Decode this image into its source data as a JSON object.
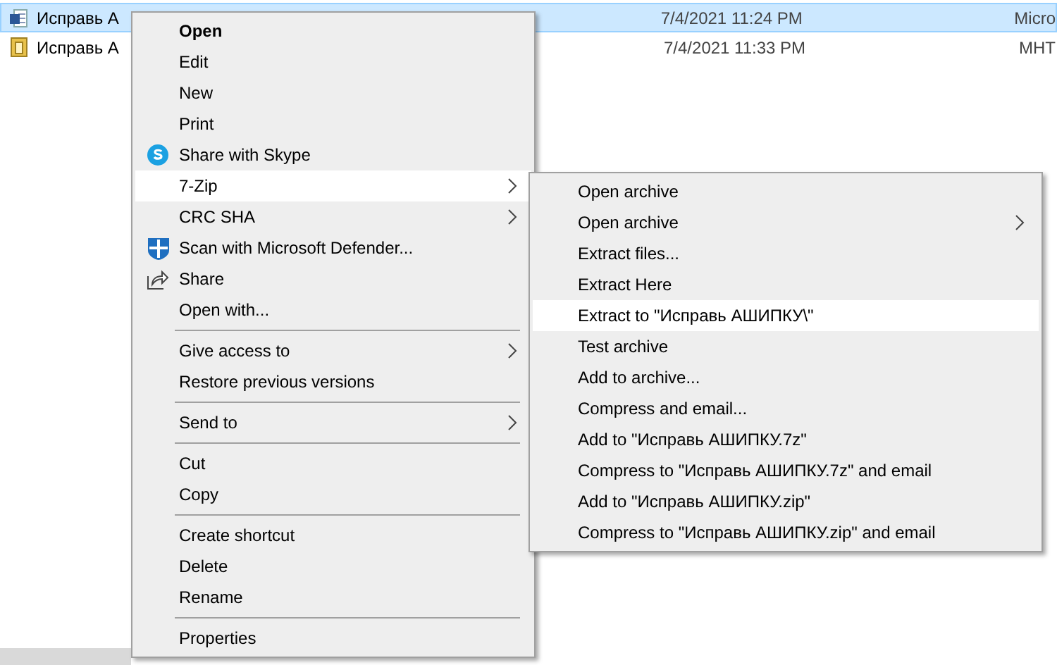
{
  "files": [
    {
      "name": "Исправь А",
      "date": "7/4/2021 11:24 PM",
      "type": "Micro",
      "selected": true
    },
    {
      "name": "Исправь А",
      "date": "7/4/2021 11:33 PM",
      "type": "MHT",
      "selected": false
    }
  ],
  "context_menu": {
    "items": [
      {
        "kind": "item",
        "label": "Open",
        "default": true,
        "selected": false
      },
      {
        "kind": "item",
        "label": "Edit",
        "selected": false
      },
      {
        "kind": "item",
        "label": "New",
        "selected": false
      },
      {
        "kind": "item",
        "label": "Print",
        "selected": false
      },
      {
        "kind": "item",
        "label": "Share with Skype",
        "selected": false
      },
      {
        "kind": "item",
        "label": "7-Zip",
        "submenu": true,
        "selected": true
      },
      {
        "kind": "item",
        "label": "CRC SHA",
        "submenu": true,
        "selected": false
      },
      {
        "kind": "item",
        "label": "Scan with Microsoft Defender...",
        "selected": false
      },
      {
        "kind": "item",
        "label": "Share",
        "selected": false
      },
      {
        "kind": "item",
        "label": "Open with...",
        "selected": false
      },
      {
        "kind": "separator"
      },
      {
        "kind": "item",
        "label": "Give access to",
        "submenu": true,
        "selected": false
      },
      {
        "kind": "item",
        "label": "Restore previous versions",
        "selected": false
      },
      {
        "kind": "separator"
      },
      {
        "kind": "item",
        "label": "Send to",
        "submenu": true,
        "selected": false
      },
      {
        "kind": "separator"
      },
      {
        "kind": "item",
        "label": "Cut",
        "selected": false
      },
      {
        "kind": "item",
        "label": "Copy",
        "selected": false
      },
      {
        "kind": "separator"
      },
      {
        "kind": "item",
        "label": "Create shortcut",
        "selected": false
      },
      {
        "kind": "item",
        "label": "Delete",
        "selected": false
      },
      {
        "kind": "item",
        "label": "Rename",
        "selected": false
      },
      {
        "kind": "separator"
      },
      {
        "kind": "item",
        "label": "Properties",
        "selected": false
      }
    ]
  },
  "submenu": {
    "items": [
      {
        "kind": "item",
        "label": "Open archive",
        "selected": false
      },
      {
        "kind": "item",
        "label": "Open archive",
        "submenu": true,
        "selected": false
      },
      {
        "kind": "item",
        "label": "Extract files...",
        "selected": false
      },
      {
        "kind": "item",
        "label": "Extract Here",
        "selected": false
      },
      {
        "kind": "item",
        "label": "Extract to \"Исправь АШИПКУ\\\"",
        "selected": true
      },
      {
        "kind": "item",
        "label": "Test archive",
        "selected": false
      },
      {
        "kind": "item",
        "label": "Add to archive...",
        "selected": false
      },
      {
        "kind": "item",
        "label": "Compress and email...",
        "selected": false
      },
      {
        "kind": "item",
        "label": "Add to \"Исправь АШИПКУ.7z\"",
        "selected": false
      },
      {
        "kind": "item",
        "label": "Compress to \"Исправь АШИПКУ.7z\" and email",
        "selected": false
      },
      {
        "kind": "item",
        "label": "Add to \"Исправь АШИПКУ.zip\"",
        "selected": false
      },
      {
        "kind": "item",
        "label": "Compress to \"Исправь АШИПКУ.zip\" and email",
        "selected": false
      }
    ]
  }
}
